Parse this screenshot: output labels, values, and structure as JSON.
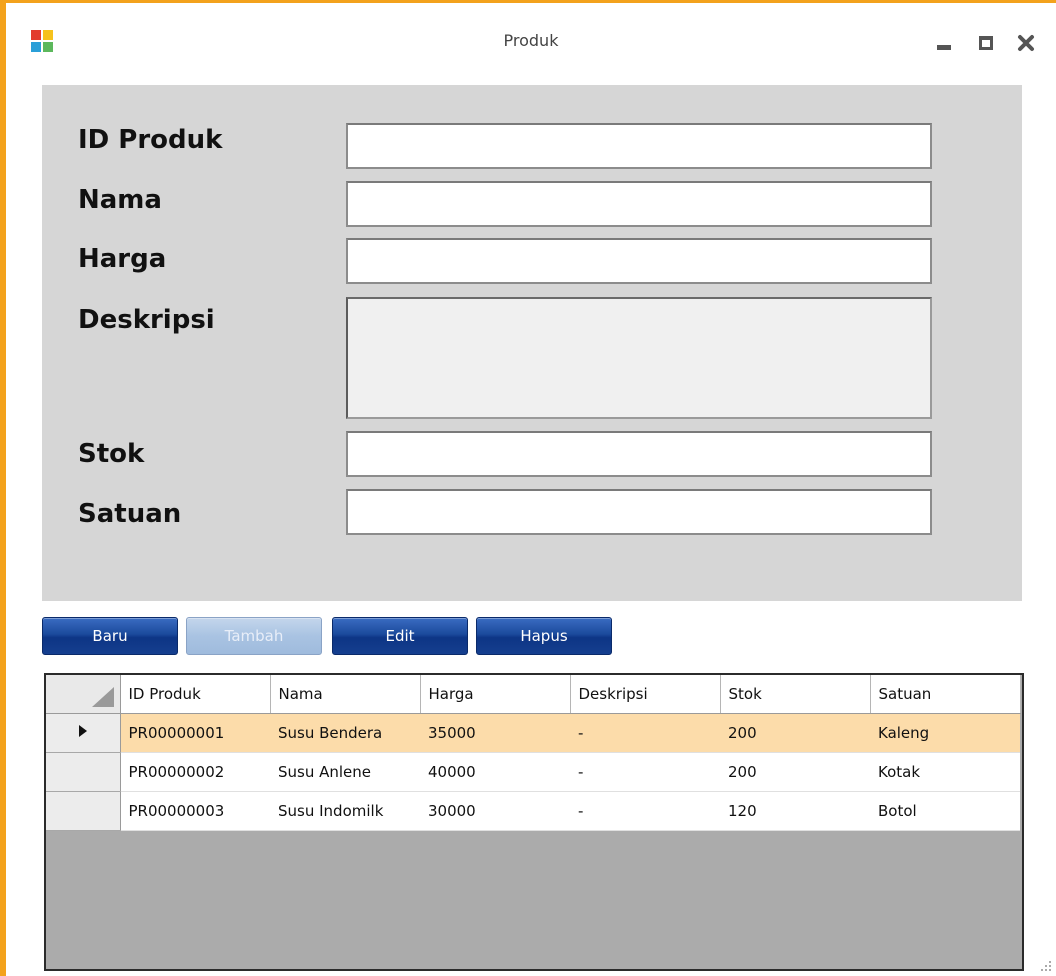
{
  "window": {
    "title": "Produk",
    "colors": {
      "frame": "#f3a21c",
      "panel": "#d6d6d6",
      "selected_row": "#fcdcaa"
    }
  },
  "form": {
    "labels": {
      "id_produk": "ID Produk",
      "nama": "Nama",
      "harga": "Harga",
      "deskripsi": "Deskripsi",
      "stok": "Stok",
      "satuan": "Satuan"
    },
    "values": {
      "id_produk": "",
      "nama": "",
      "harga": "",
      "deskripsi": "",
      "stok": "",
      "satuan": ""
    }
  },
  "buttons": {
    "baru": "Baru",
    "tambah": "Tambah",
    "edit": "Edit",
    "hapus": "Hapus"
  },
  "grid": {
    "columns": [
      "ID Produk",
      "Nama",
      "Harga",
      "Deskripsi",
      "Stok",
      "Satuan"
    ],
    "rows": [
      [
        "PR00000001",
        "Susu Bendera",
        "35000",
        "-",
        "200",
        "Kaleng"
      ],
      [
        "PR00000002",
        "Susu Anlene",
        "40000",
        "-",
        "200",
        "Kotak"
      ],
      [
        "PR00000003",
        "Susu Indomilk",
        "30000",
        "-",
        "120",
        "Botol"
      ]
    ],
    "selected_row": 0
  }
}
